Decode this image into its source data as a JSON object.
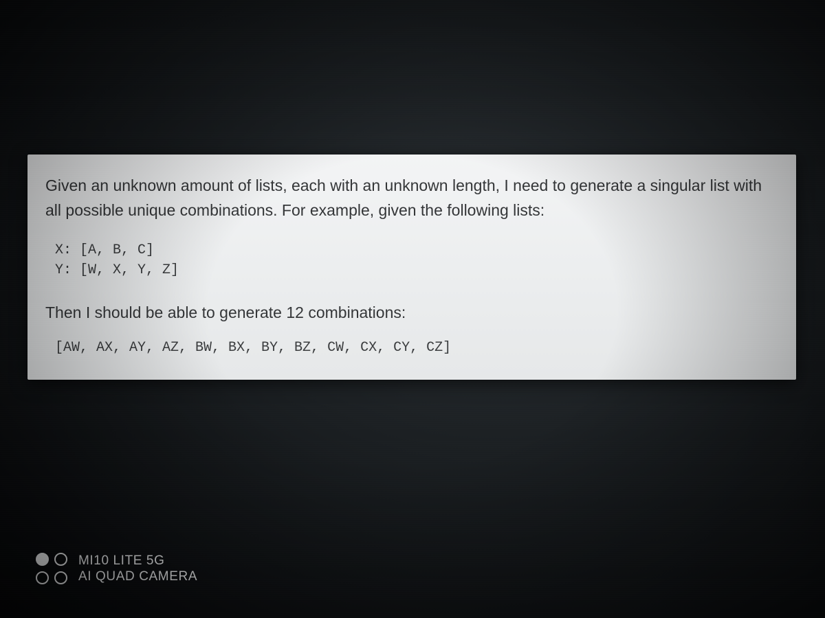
{
  "card": {
    "intro": "Given an unknown amount of lists, each with an unknown length, I need to generate a singular list with all possible unique combinations. For example, given the following lists:",
    "code_input": "X: [A, B, C]\nY: [W, X, Y, Z]",
    "mid": "Then I should be able to generate 12 combinations:",
    "code_output": "[AW, AX, AY, AZ, BW, BX, BY, BZ, CW, CX, CY, CZ]"
  },
  "watermark": {
    "line1": "MI10 LITE 5G",
    "line2": "AI QUAD CAMERA"
  }
}
